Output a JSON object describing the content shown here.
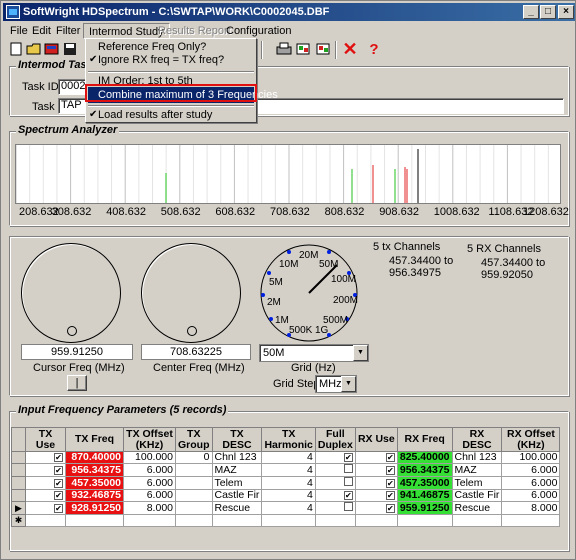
{
  "window": {
    "title": "SoftWright HDSpectrum - C:\\SWTAP\\WORK\\C0002045.DBF",
    "min": "_",
    "max": "□",
    "close": "×"
  },
  "menu": {
    "file": "File",
    "edit": "Edit",
    "filter": "Filter",
    "intermod": "Intermod Study",
    "results": "Results Report",
    "configuration": "Configuration"
  },
  "dropdown": {
    "items": [
      "Reference Freq Only?",
      "Ignore RX freq = TX freq?",
      "IM Order: 1st to 5th",
      "Combine maximum of 3 Frequencies",
      "Load results after study"
    ],
    "check": "✔"
  },
  "intermod_task": {
    "title": "Intermod Task",
    "task_id_label": "Task ID:",
    "task_id_value": "0002",
    "task_label": "Task",
    "task_value": "TAP"
  },
  "spectrum": {
    "title": "Spectrum Analyzer",
    "ticks": [
      "208.632",
      "308.632",
      "408.632",
      "508.632",
      "608.632",
      "708.632",
      "808.632",
      "908.632",
      "1008.632",
      "1108.632",
      "1208.632"
    ]
  },
  "controls": {
    "cursor_freq_value": "959.91250",
    "cursor_freq_label": "Cursor Freq (MHz)",
    "center_freq_value": "708.63225",
    "center_freq_label": "Center Freq (MHz)",
    "cursor_button": "|",
    "grid_value": "50M",
    "grid_label": "Grid (Hz)",
    "grid_step_label": "Grid Step",
    "grid_step_value": "MHz",
    "dial_labels": [
      "20M",
      "50M",
      "10M",
      "100M",
      "5M",
      "200M",
      "2M",
      "1M",
      "500M",
      "500K",
      "1G"
    ],
    "tx_channels_label": "5 tx Channels",
    "tx_range_start": "457.34400 to",
    "tx_range_end": "956.34975",
    "rx_channels_label": "5 RX Channels",
    "rx_range_start": "457.34400 to",
    "rx_range_end": "959.92050"
  },
  "input_params": {
    "title": "Input Frequency Parameters (5 records)",
    "columns": [
      "TX Use",
      "TX Freq",
      "TX Offset (KHz)",
      "TX Group",
      "TX DESC",
      "TX Harmonic",
      "Full Duplex",
      "RX Use",
      "RX Freq",
      "RX DESC",
      "RX Offset (KHz)"
    ],
    "rows": [
      {
        "tx_freq": "870.40000",
        "tx_offset": "100.000",
        "tx_group": "0",
        "tx_desc": "Chnl 123",
        "harmonic": "4",
        "rx_freq": "825.40000",
        "rx_desc": "Chnl 123",
        "rx_offset": "100.000"
      },
      {
        "tx_freq": "956.34375",
        "tx_offset": "6.000",
        "tx_group": "",
        "tx_desc": "MAZ",
        "harmonic": "4",
        "rx_freq": "956.34375",
        "rx_desc": "MAZ",
        "rx_offset": "6.000"
      },
      {
        "tx_freq": "457.35000",
        "tx_offset": "6.000",
        "tx_group": "",
        "tx_desc": "Telem",
        "harmonic": "4",
        "rx_freq": "457.35000",
        "rx_desc": "Telem",
        "rx_offset": "6.000"
      },
      {
        "tx_freq": "932.46875",
        "tx_offset": "6.000",
        "tx_group": "",
        "tx_desc": "Castle Fir",
        "harmonic": "4",
        "rx_freq": "941.46875",
        "rx_desc": "Castle Fir",
        "rx_offset": "6.000"
      },
      {
        "tx_freq": "928.91250",
        "tx_offset": "8.000",
        "tx_group": "",
        "tx_desc": "Rescue",
        "harmonic": "4",
        "rx_freq": "959.91250",
        "rx_desc": "Rescue",
        "rx_offset": "8.000"
      }
    ]
  }
}
